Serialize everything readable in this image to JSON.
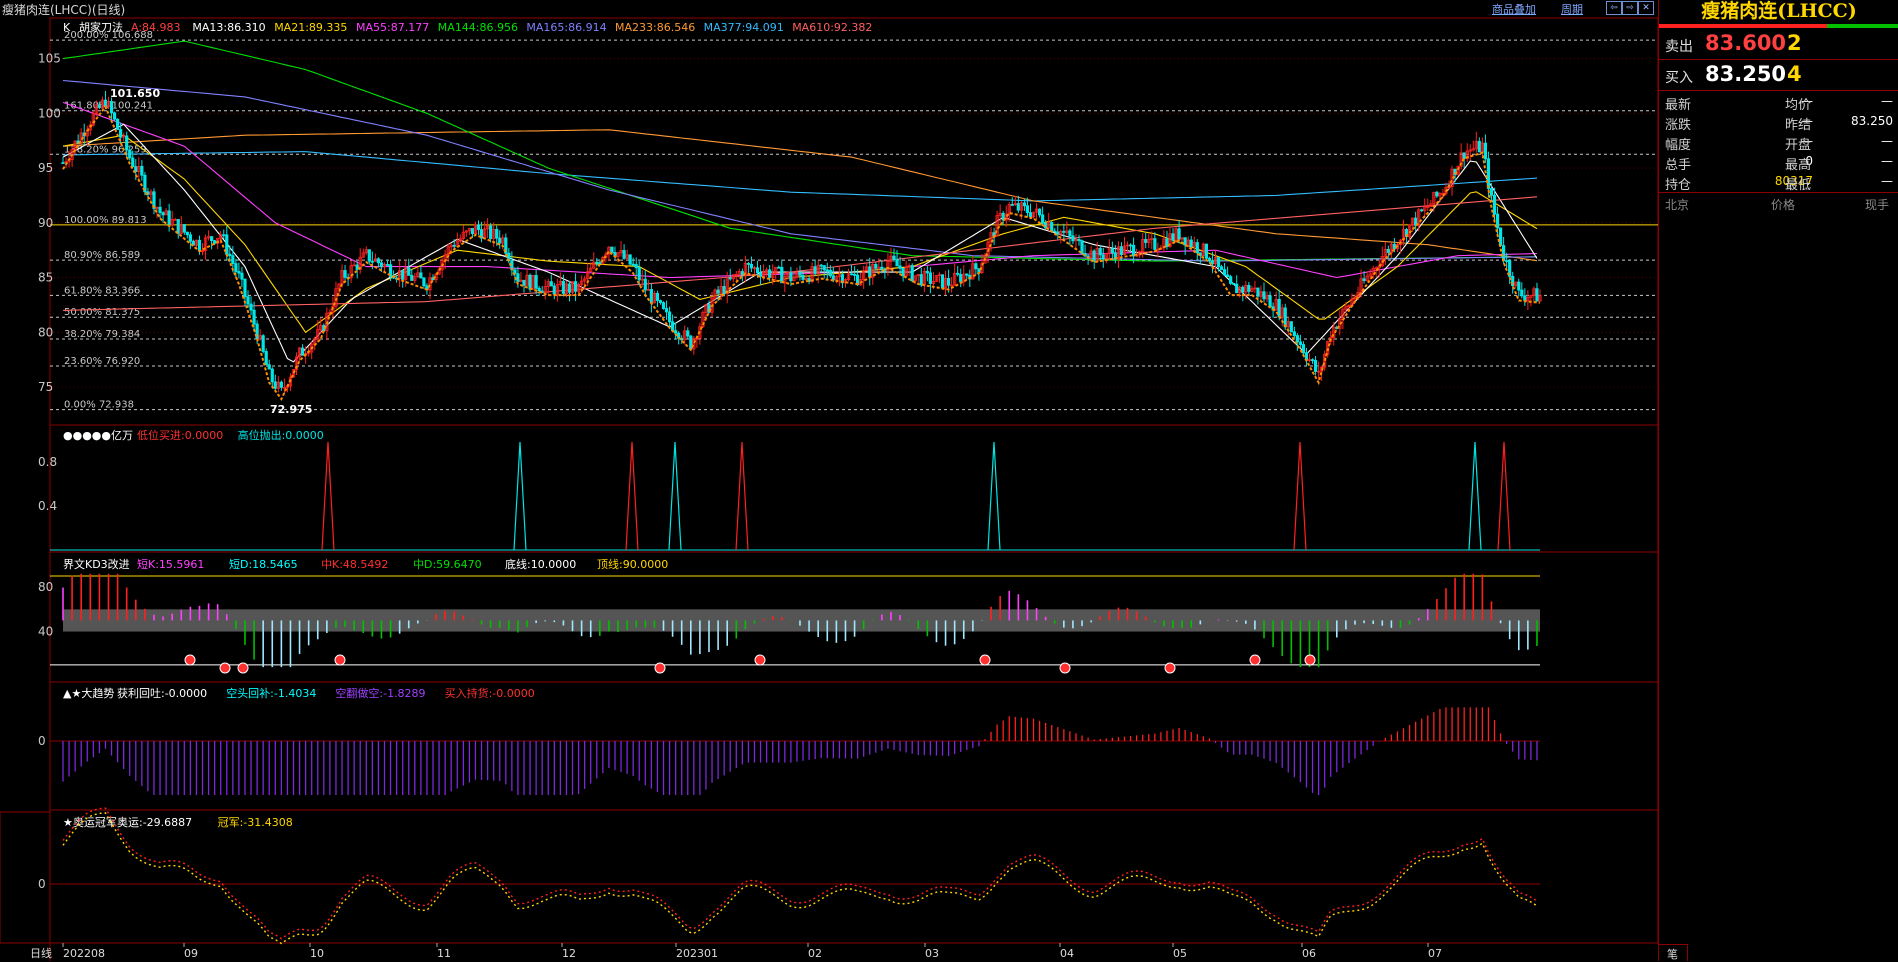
{
  "window": {
    "title": "瘦猪肉连(LHCC)(日线)",
    "links": {
      "overlay": "商品叠加",
      "period": "周期"
    },
    "buttons": [
      "⇦",
      "⇨",
      "✕"
    ]
  },
  "main_panel": {
    "indicator": "K",
    "study": "胡家刀法",
    "ma_values": [
      {
        "label": "A:84.983",
        "color": "#ff4040"
      },
      {
        "label": "MA13:86.310",
        "color": "#ffffff"
      },
      {
        "label": "MA21:89.335",
        "color": "#ffd700"
      },
      {
        "label": "MA55:87.177",
        "color": "#ff40ff"
      },
      {
        "label": "MA144:86.956",
        "color": "#00e000"
      },
      {
        "label": "MA165:86.914",
        "color": "#8080ff"
      },
      {
        "label": "MA233:86.546",
        "color": "#ff9933"
      },
      {
        "label": "MA377:94.091",
        "color": "#33bbff"
      },
      {
        "label": "MA610:92.382",
        "color": "#ff6060"
      }
    ],
    "y_ticks": [
      "105",
      "100",
      "95",
      "90",
      "85",
      "80",
      "75"
    ],
    "fib_levels": [
      {
        "label": "200.00% 106.688",
        "value": 106.688
      },
      {
        "label": "161.80% 100.241",
        "value": 100.241
      },
      {
        "label": "138.20% 96.259",
        "value": 96.259
      },
      {
        "label": "100.00% 89.813",
        "value": 89.813
      },
      {
        "label": "80.90% 86.589",
        "value": 86.589
      },
      {
        "label": "61.80% 83.366",
        "value": 83.366
      },
      {
        "label": "50.00% 81.375",
        "value": 81.375
      },
      {
        "label": "38.20% 79.384",
        "value": 79.384
      },
      {
        "label": "23.60% 76.920",
        "value": 76.92
      },
      {
        "label": "0.00% 72.938",
        "value": 72.938
      }
    ],
    "annotations": {
      "high": "101.650",
      "low": "72.975"
    }
  },
  "panel2": {
    "title": "●●●●●亿万",
    "items": [
      {
        "label": "低位买进:0.0000",
        "color": "#ff3030"
      },
      {
        "label": "高位抛出:0.0000",
        "color": "#00e5e5"
      }
    ],
    "y_ticks": [
      "0.8",
      "0.4"
    ]
  },
  "panel3": {
    "title": "界文KD3改进",
    "items": [
      {
        "label": "短K:15.5961",
        "color": "#ff40ff"
      },
      {
        "label": "短D:18.5465",
        "color": "#00ffff"
      },
      {
        "label": "中K:48.5492",
        "color": "#ff3030"
      },
      {
        "label": "中D:59.6470",
        "color": "#00e000"
      },
      {
        "label": "底线:10.0000",
        "color": "#ffffff"
      },
      {
        "label": "顶线:90.0000",
        "color": "#ffd700"
      }
    ],
    "y_ticks": [
      "80",
      "40"
    ]
  },
  "panel4": {
    "title": "▲★大趋势",
    "items": [
      {
        "label": "获利回吐:-0.0000",
        "color": "#ffffff"
      },
      {
        "label": "空头回补:-1.4034",
        "color": "#00ffff"
      },
      {
        "label": "空翻做空:-1.8289",
        "color": "#a040ff"
      },
      {
        "label": "买入持货:-0.0000",
        "color": "#ff3030"
      }
    ],
    "y_ticks": [
      "0"
    ]
  },
  "panel5": {
    "title": "★奥运冠军",
    "items": [
      {
        "label": "奥运:-29.6887",
        "color": "#ffffff"
      },
      {
        "label": "冠军:-31.4308",
        "color": "#ffd700"
      }
    ],
    "y_ticks": [
      "0"
    ]
  },
  "x_axis": {
    "period_label": "日线",
    "labels": [
      "202208",
      "09",
      "10",
      "11",
      "12",
      "202301",
      "02",
      "03",
      "04",
      "05",
      "06",
      "07"
    ]
  },
  "sidebar": {
    "title": "瘦猪肉连(LHCC)",
    "sell": {
      "label": "卖出",
      "price": "83.600",
      "volume": "2"
    },
    "buy": {
      "label": "买入",
      "price": "83.250",
      "volume": "4"
    },
    "stats": [
      {
        "label": "最新",
        "value": "—",
        "label2": "均价",
        "value2": "—"
      },
      {
        "label": "涨跌",
        "value": "—",
        "label2": "昨结",
        "value2": "83.250"
      },
      {
        "label": "幅度",
        "value": "—",
        "label2": "开盘",
        "value2": "—"
      },
      {
        "label": "总手",
        "value": "0",
        "label2": "最高",
        "value2": "—"
      },
      {
        "label": "持仓",
        "value": "80317",
        "label2": "最低",
        "value2": "—"
      }
    ],
    "trades_header": [
      "北京",
      "价格",
      "现手"
    ],
    "bottom_tab": "笔"
  },
  "colors": {
    "up": "#ff2020",
    "down": "#00e5e5",
    "grid": "#8b0000",
    "yellow": "#ffd700"
  },
  "chart_data": {
    "type": "candlestick",
    "title": "瘦猪肉连(LHCC)(日线)",
    "x_labels": [
      "202208",
      "09",
      "10",
      "11",
      "12",
      "202301",
      "02",
      "03",
      "04",
      "05",
      "06",
      "07"
    ],
    "ylim": [
      72,
      107
    ],
    "price_path": [
      [
        0,
        95.5
      ],
      [
        8,
        99
      ],
      [
        14,
        101.2
      ],
      [
        22,
        96
      ],
      [
        32,
        91
      ],
      [
        45,
        88
      ],
      [
        52,
        89
      ],
      [
        58,
        85
      ],
      [
        64,
        80
      ],
      [
        68,
        76
      ],
      [
        72,
        74.5
      ],
      [
        78,
        78
      ],
      [
        85,
        80
      ],
      [
        92,
        85
      ],
      [
        100,
        87
      ],
      [
        110,
        85.5
      ],
      [
        120,
        84.5
      ],
      [
        128,
        88
      ],
      [
        136,
        89.5
      ],
      [
        145,
        88.5
      ],
      [
        150,
        85
      ],
      [
        160,
        84
      ],
      [
        170,
        84
      ],
      [
        180,
        88
      ],
      [
        188,
        86
      ],
      [
        192,
        84
      ],
      [
        200,
        81
      ],
      [
        207,
        79
      ],
      [
        214,
        83
      ],
      [
        225,
        86
      ],
      [
        240,
        85
      ],
      [
        250,
        85.5
      ],
      [
        262,
        85
      ],
      [
        272,
        86.5
      ],
      [
        282,
        85
      ],
      [
        292,
        84.5
      ],
      [
        302,
        86
      ],
      [
        308,
        90
      ],
      [
        312,
        91.5
      ],
      [
        320,
        91
      ],
      [
        330,
        89
      ],
      [
        340,
        87
      ],
      [
        350,
        87.5
      ],
      [
        360,
        88
      ],
      [
        368,
        89
      ],
      [
        378,
        87
      ],
      [
        385,
        84
      ],
      [
        392,
        84
      ],
      [
        400,
        82.5
      ],
      [
        408,
        79
      ],
      [
        414,
        76
      ],
      [
        418,
        80
      ],
      [
        425,
        83
      ],
      [
        435,
        87
      ],
      [
        445,
        90
      ],
      [
        455,
        93
      ],
      [
        462,
        96.5
      ],
      [
        468,
        97
      ],
      [
        471,
        92
      ],
      [
        475,
        87
      ],
      [
        480,
        83.5
      ],
      [
        487,
        83.3
      ]
    ],
    "ma_paths": [
      {
        "name": "MA377",
        "color": "#33bbff",
        "points": [
          [
            0,
            96.2
          ],
          [
            80,
            96.5
          ],
          [
            160,
            94.5
          ],
          [
            240,
            92.8
          ],
          [
            320,
            92
          ],
          [
            400,
            92.5
          ],
          [
            487,
            94.1
          ]
        ]
      },
      {
        "name": "MA233",
        "color": "#ff9933",
        "points": [
          [
            0,
            97
          ],
          [
            60,
            98
          ],
          [
            180,
            98.5
          ],
          [
            260,
            96
          ],
          [
            320,
            92
          ],
          [
            400,
            89
          ],
          [
            450,
            88
          ],
          [
            487,
            86.5
          ]
        ]
      },
      {
        "name": "MA144",
        "color": "#00e000",
        "points": [
          [
            0,
            105
          ],
          [
            40,
            106.6
          ],
          [
            80,
            104
          ],
          [
            120,
            100
          ],
          [
            160,
            95
          ],
          [
            220,
            89.5
          ],
          [
            280,
            87
          ],
          [
            360,
            86.5
          ],
          [
            487,
            86.9
          ]
        ]
      },
      {
        "name": "MA165",
        "color": "#8080ff",
        "points": [
          [
            0,
            103
          ],
          [
            60,
            101.5
          ],
          [
            120,
            98
          ],
          [
            180,
            93
          ],
          [
            240,
            89
          ],
          [
            300,
            87
          ],
          [
            380,
            86.5
          ],
          [
            487,
            86.9
          ]
        ]
      },
      {
        "name": "MA55",
        "color": "#ff40ff",
        "points": [
          [
            0,
            101
          ],
          [
            40,
            97
          ],
          [
            70,
            90
          ],
          [
            100,
            86
          ],
          [
            140,
            86
          ],
          [
            200,
            85
          ],
          [
            260,
            85.5
          ],
          [
            320,
            87
          ],
          [
            380,
            87.5
          ],
          [
            420,
            85
          ],
          [
            460,
            87
          ],
          [
            487,
            87.2
          ]
        ]
      },
      {
        "name": "MA21",
        "color": "#ffd700",
        "points": [
          [
            0,
            97
          ],
          [
            20,
            98
          ],
          [
            40,
            94
          ],
          [
            60,
            88
          ],
          [
            80,
            80
          ],
          [
            100,
            84
          ],
          [
            130,
            87.5
          ],
          [
            160,
            86.5
          ],
          [
            190,
            86
          ],
          [
            210,
            83
          ],
          [
            240,
            85
          ],
          [
            280,
            86
          ],
          [
            310,
            89
          ],
          [
            330,
            90.5
          ],
          [
            360,
            89
          ],
          [
            390,
            86
          ],
          [
            415,
            81
          ],
          [
            440,
            86
          ],
          [
            465,
            93
          ],
          [
            487,
            89.3
          ]
        ]
      },
      {
        "name": "MA13",
        "color": "#ffffff",
        "points": [
          [
            0,
            96
          ],
          [
            20,
            99
          ],
          [
            40,
            93
          ],
          [
            60,
            86
          ],
          [
            75,
            77
          ],
          [
            95,
            83
          ],
          [
            130,
            88.5
          ],
          [
            160,
            85.5
          ],
          [
            200,
            80.5
          ],
          [
            230,
            85.5
          ],
          [
            280,
            85.5
          ],
          [
            310,
            90.5
          ],
          [
            340,
            88
          ],
          [
            380,
            86
          ],
          [
            410,
            78
          ],
          [
            440,
            87
          ],
          [
            465,
            96
          ],
          [
            487,
            86.3
          ]
        ]
      },
      {
        "name": "MA610",
        "color": "#ff6060",
        "points": [
          [
            0,
            82
          ],
          [
            120,
            82.8
          ],
          [
            240,
            85.5
          ],
          [
            360,
            89.5
          ],
          [
            487,
            92.4
          ]
        ]
      }
    ],
    "sub_panels": [
      "亿万",
      "界文KD3改进",
      "大趋势",
      "奥运冠军"
    ]
  }
}
